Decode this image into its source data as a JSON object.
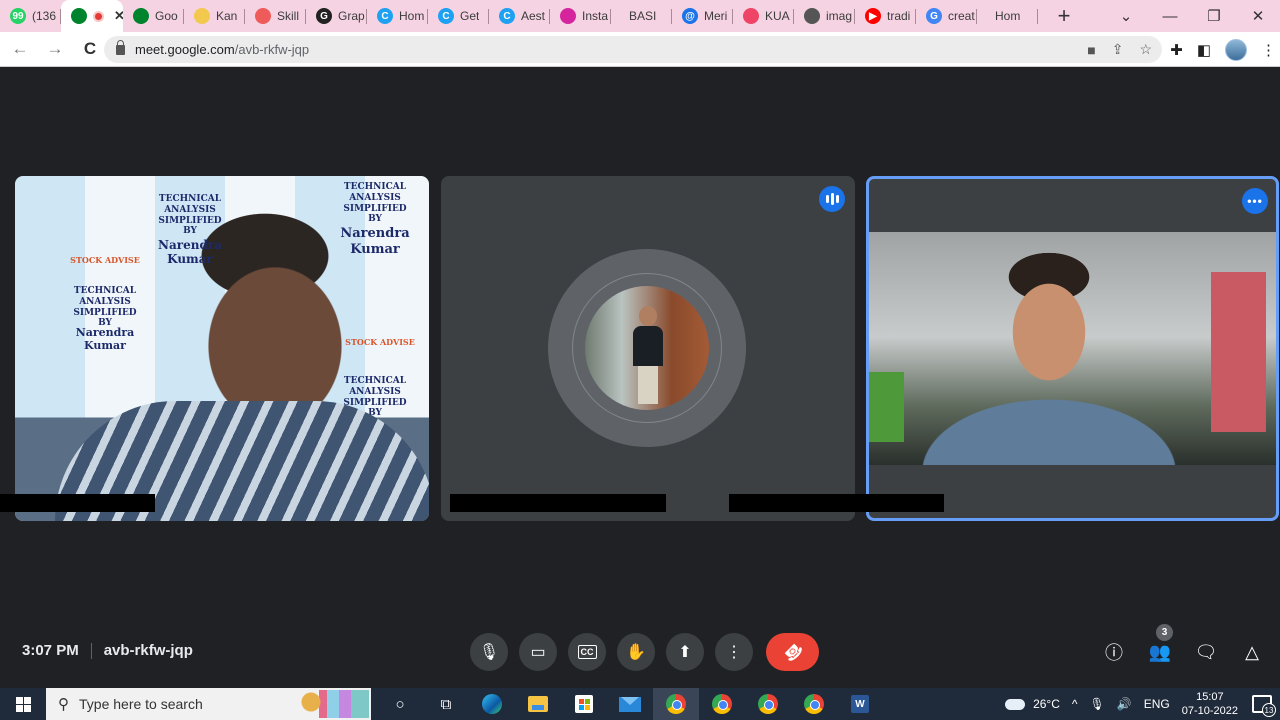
{
  "browser": {
    "tabs": [
      {
        "title": "(136",
        "icon": "whatsapp-icon",
        "color": "#25d366",
        "glyph": "99"
      },
      {
        "title": "",
        "icon": "google-meet-icon",
        "color": "#00832d",
        "glyph": "",
        "active": true,
        "recording": true,
        "close": "✕"
      },
      {
        "title": "Goo",
        "icon": "google-meet-icon",
        "color": "#00832d",
        "glyph": ""
      },
      {
        "title": "Kan",
        "icon": "kannada-icon",
        "color": "#f2c94c",
        "glyph": ""
      },
      {
        "title": "Skill",
        "icon": "skill-icon",
        "color": "#ef5b5b",
        "glyph": ""
      },
      {
        "title": "Grap",
        "icon": "grammarly-icon",
        "color": "#222222",
        "glyph": "G"
      },
      {
        "title": "Hom",
        "icon": "canva-icon",
        "color": "#1ea1f2",
        "glyph": "C"
      },
      {
        "title": "Get",
        "icon": "canva-icon",
        "color": "#1ea1f2",
        "glyph": "C"
      },
      {
        "title": "Aest",
        "icon": "canva-icon",
        "color": "#1ea1f2",
        "glyph": "C"
      },
      {
        "title": "Insta",
        "icon": "instagram-icon",
        "color": "#d6249f",
        "glyph": ""
      },
      {
        "title": "BASI",
        "icon": "",
        "color": "",
        "glyph": ""
      },
      {
        "title": "Meri",
        "icon": "at-sign-icon",
        "color": "#1a73e8",
        "glyph": "@"
      },
      {
        "title": "KUA",
        "icon": "kua-icon",
        "color": "#ee4466",
        "glyph": ""
      },
      {
        "title": "imag",
        "icon": "globe-icon",
        "color": "#555555",
        "glyph": ""
      },
      {
        "title": "tradi",
        "icon": "youtube-icon",
        "color": "#ff0000",
        "glyph": "▶"
      },
      {
        "title": "creat",
        "icon": "google-icon",
        "color": "#4285f4",
        "glyph": "G"
      },
      {
        "title": "Hom",
        "icon": "",
        "color": "",
        "glyph": ""
      }
    ],
    "new_tab": "+",
    "window_controls": {
      "tab_search": "⌄",
      "minimize": "—",
      "restore": "❐",
      "close": "✕"
    },
    "address": {
      "host": "meet.google.com",
      "path": "/avb-rkfw-jqp"
    },
    "nav": {
      "back": "←",
      "forward": "→",
      "reload": "C"
    }
  },
  "meet": {
    "time": "3:07 PM",
    "meeting_code": "avb-rkfw-jqp",
    "participant_count": "3",
    "tile1_background_text": [
      "TECHNICAL ANALYSIS SIMPLIFIED BY",
      "Narendra Kumar",
      "STOCK ADVISE"
    ],
    "controls": [
      {
        "name": "microphone-button",
        "icon": "microphone-icon",
        "glyph": "🎙"
      },
      {
        "name": "camera-button",
        "icon": "camera-icon",
        "glyph": "▭"
      },
      {
        "name": "captions-button",
        "icon": "captions-icon",
        "glyph": "CC"
      },
      {
        "name": "raise-hand-button",
        "icon": "hand-icon",
        "glyph": "✋"
      },
      {
        "name": "present-button",
        "icon": "present-screen-icon",
        "glyph": "⬆"
      },
      {
        "name": "more-options-button",
        "icon": "more-vertical-icon",
        "glyph": "⋮"
      }
    ],
    "hangup_glyph": "☎",
    "right_controls": [
      {
        "name": "meeting-details-button",
        "icon": "info-icon",
        "glyph": "ⓘ"
      },
      {
        "name": "people-button",
        "icon": "people-icon",
        "glyph": "👥"
      },
      {
        "name": "chat-button",
        "icon": "chat-icon",
        "glyph": "🗨"
      },
      {
        "name": "activities-button",
        "icon": "activities-icon",
        "glyph": "△"
      }
    ],
    "colors": {
      "accent": "#1a73e8",
      "hangup": "#ea4335",
      "active_border": "#669df6"
    }
  },
  "taskbar": {
    "search_placeholder": "Type here to search",
    "weather": "26°C",
    "language": "ENG",
    "time": "15:07",
    "date": "07-10-2022",
    "notification_count": "13"
  }
}
